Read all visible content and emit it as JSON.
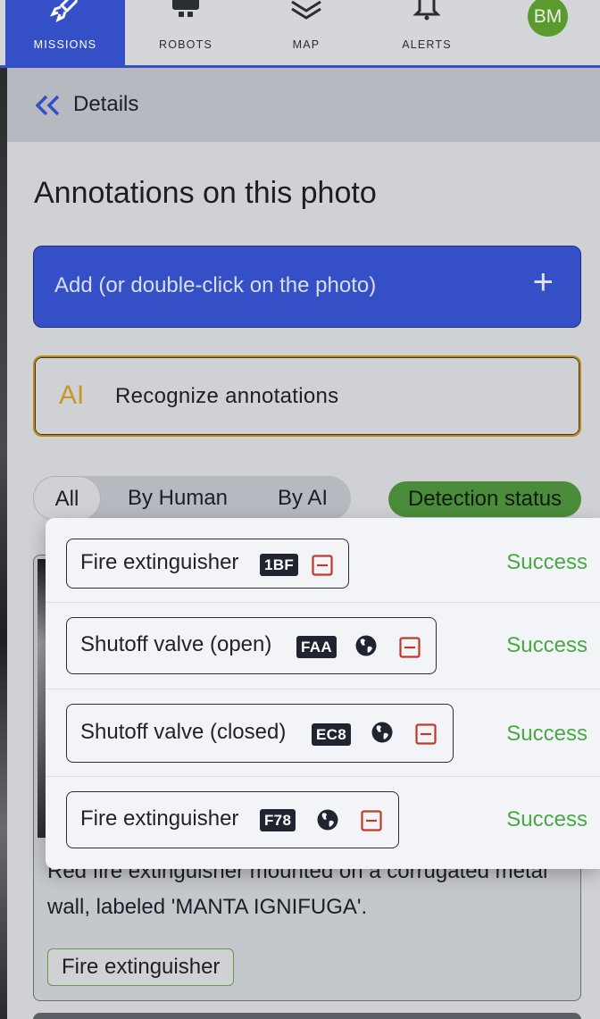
{
  "nav": {
    "items": [
      {
        "label": "MISSIONS",
        "icon": "rocket-icon",
        "active": true
      },
      {
        "label": "ROBOTS",
        "icon": "robot-icon",
        "active": false
      },
      {
        "label": "MAP",
        "icon": "layers-icon",
        "active": false
      },
      {
        "label": "ALERTS",
        "icon": "bell-icon",
        "active": false
      }
    ],
    "avatar": "BM"
  },
  "panel": {
    "back_label": "Details",
    "title": "Annotations on this photo",
    "add_label": "Add (or double-click on the photo)",
    "add_icon": "+",
    "ai_mark": "AI",
    "ai_label": "Recognize annotations",
    "filters": [
      "All",
      "By Human",
      "By AI"
    ],
    "active_filter": "All",
    "detection_status": "Detection status"
  },
  "photo": {
    "caption": "Red fire extinguisher mounted on a corrugated metal wall, labeled 'MANTA IGNIFUGA'.",
    "tag": "Fire extinguisher"
  },
  "detections": [
    {
      "label": "Fire extinguisher",
      "code": "1BF",
      "globe": false,
      "status": "Success"
    },
    {
      "label": "Shutoff valve (open)",
      "code": "FAA",
      "globe": true,
      "status": "Success"
    },
    {
      "label": "Shutoff valve (closed)",
      "code": "EC8",
      "globe": true,
      "status": "Success"
    },
    {
      "label": "Fire extinguisher",
      "code": "F78",
      "globe": true,
      "status": "Success"
    }
  ],
  "colors": {
    "accent": "#3550c6",
    "success": "#4aa843",
    "ai_border": "#b98b16",
    "badge_green": "#4b8c3a",
    "remove_red": "#c0392b"
  }
}
